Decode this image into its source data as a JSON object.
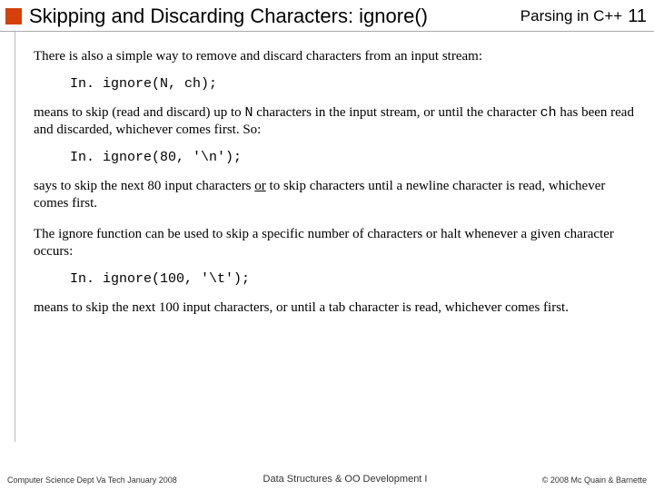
{
  "header": {
    "title": "Skipping and Discarding Characters:  ignore()",
    "subtitle": "Parsing in C++",
    "page_number": "11"
  },
  "content": {
    "p1": "There is also a simple way to remove and discard characters from an input stream:",
    "code1": "In. ignore(N, ch);",
    "p2a": "means to skip (read and discard) up to ",
    "p2code1": "N",
    "p2b": " characters in the input stream, or until the character ",
    "p2code2": "ch",
    "p2c": " has been read and discarded, whichever comes first.  So:",
    "code2": "In. ignore(80, '\\n');",
    "p3a": "says to skip the next 80 input characters ",
    "p3u": "or",
    "p3b": " to skip characters until a newline character is read, whichever comes first.",
    "p4": "The ignore function can be used to skip a specific number of characters or halt whenever a given character occurs:",
    "code3": "In. ignore(100, '\\t');",
    "p5": "means to skip the next 100 input characters, or until a tab character is read, whichever comes first."
  },
  "footer": {
    "left": "Computer Science Dept Va Tech January 2008",
    "center": "Data Structures & OO Development I",
    "right": "© 2008  Mc Quain & Barnette"
  }
}
